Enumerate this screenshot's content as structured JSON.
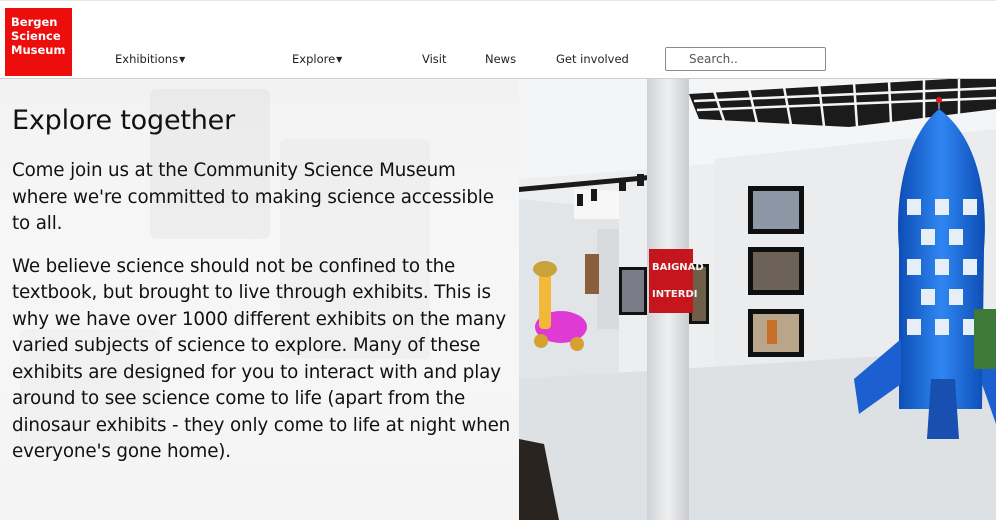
{
  "logo": {
    "lines": [
      "Bergen",
      "Science",
      "Museum"
    ],
    "color": "#ee0d0d"
  },
  "nav": {
    "exhibitions": "Exhibitions",
    "explore": "Explore",
    "visit": "Visit",
    "news": "News",
    "get_involved": "Get involved"
  },
  "search": {
    "placeholder": "Search.."
  },
  "main": {
    "title": "Explore together",
    "paragraphs": [
      "Come join us at the Community Science Museum where we're committed to making science accessible to all.",
      "We believe science should not be confined to the textbook, but brought to live through exhibits. This is why we have over 1000 different exhibits on the many varied subjects of science to explore. Many of these exhibits are designed for you to interact with and play around to see science come to life (apart from the dinosaur exhibits - they only come to life at night when everyone's gone home)."
    ]
  },
  "hero_image": {
    "pillar_sign": [
      "BAIGNAD",
      "INTERDI"
    ],
    "rocket_color": "#1e6ad8"
  }
}
